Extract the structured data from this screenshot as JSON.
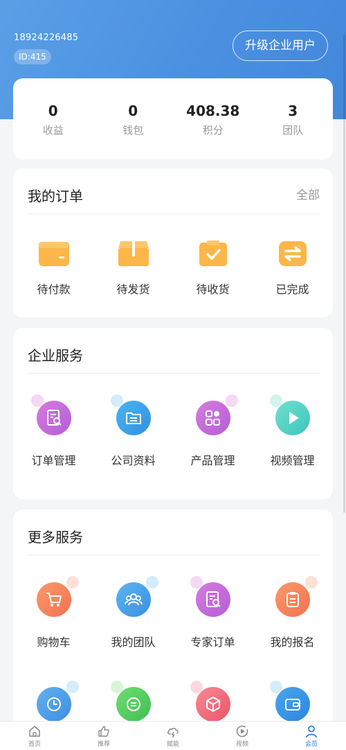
{
  "header": {
    "phone": "18924226485",
    "id_label": "ID:415",
    "upgrade_label": "升级企业用户"
  },
  "stats": [
    {
      "value": "0",
      "label": "收益"
    },
    {
      "value": "0",
      "label": "钱包"
    },
    {
      "value": "408.38",
      "label": "积分"
    },
    {
      "value": "3",
      "label": "团队"
    }
  ],
  "orders": {
    "title": "我的订单",
    "all_label": "全部",
    "items": [
      {
        "label": "待付款",
        "icon": "wallet-icon"
      },
      {
        "label": "待发货",
        "icon": "package-icon"
      },
      {
        "label": "待收货",
        "icon": "clipboard-check-icon"
      },
      {
        "label": "已完成",
        "icon": "exchange-icon"
      }
    ]
  },
  "enterprise": {
    "title": "企业服务",
    "items": [
      {
        "label": "订单管理",
        "icon": "document-search-icon",
        "color": "#c46ad9"
      },
      {
        "label": "公司资料",
        "icon": "folder-icon",
        "color": "#3aa3ea"
      },
      {
        "label": "产品管理",
        "icon": "grid-apps-icon",
        "color": "#c86bdc"
      },
      {
        "label": "视频管理",
        "icon": "play-icon",
        "color": "#4fd1c5"
      }
    ]
  },
  "more": {
    "title": "更多服务",
    "items": [
      {
        "label": "购物车",
        "icon": "cart-icon",
        "color": "#f5825e"
      },
      {
        "label": "我的团队",
        "icon": "team-icon",
        "color": "#4aa2ec"
      },
      {
        "label": "专家订单",
        "icon": "document-search-icon",
        "color": "#c46ad9"
      },
      {
        "label": "我的报名",
        "icon": "clipboard-icon",
        "color": "#f5825e"
      }
    ],
    "items_row2": [
      {
        "icon": "clock-icon",
        "color": "#4a9bea"
      },
      {
        "icon": "message-icon",
        "color": "#4fcf5e"
      },
      {
        "icon": "box-icon",
        "color": "#f26a7a"
      },
      {
        "icon": "wallet-card-icon",
        "color": "#2f8fe0"
      }
    ]
  },
  "tabbar": [
    {
      "label": "首页",
      "icon": "home-icon"
    },
    {
      "label": "推荐",
      "icon": "thumbs-up-icon"
    },
    {
      "label": "赋能",
      "icon": "cloud-bolt-icon"
    },
    {
      "label": "视频",
      "icon": "play-circle-icon"
    },
    {
      "label": "会员",
      "icon": "user-icon",
      "active": true
    }
  ],
  "colors": {
    "accent": "#4a8fe0",
    "order_icon": "#fba93a",
    "active_tab": "#2f7ddc"
  }
}
